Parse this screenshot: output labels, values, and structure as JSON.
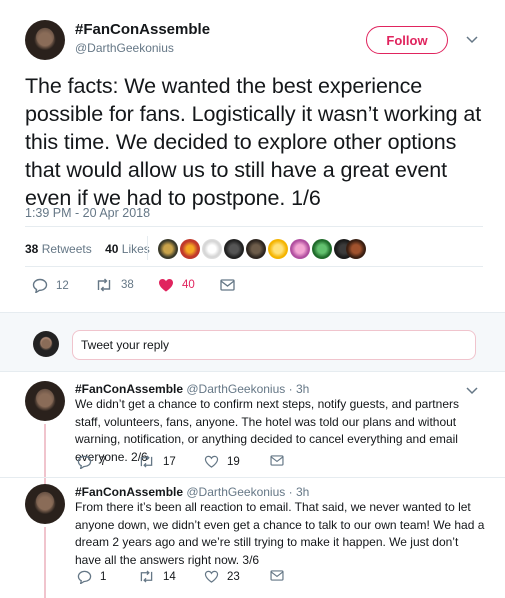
{
  "tweet": {
    "display_name": "#FanConAssemble",
    "handle": "@DarthGeekonius",
    "follow_label": "Follow",
    "text": "The facts: We wanted the best experience possible for fans. Logistically it wasn’t working at this time. We decided to explore other options that would allow us to still have a great event even if we had to postpone. 1/6",
    "timestamp": "1:39 PM - 20 Apr 2018",
    "retweets_count": "38",
    "retweets_label": "Retweets",
    "likes_count": "40",
    "likes_label": "Likes",
    "actions": {
      "replies": "12",
      "retweets": "38",
      "likes": "40"
    },
    "like_color": "#e0245e"
  },
  "reply_box": {
    "placeholder": "Tweet your reply"
  },
  "replies": [
    {
      "display_name": "#FanConAssemble",
      "handle": "@DarthGeekonius",
      "time": "· 3h",
      "text": "We didn’t get a chance to confirm next steps, notify guests, and partners staff, volunteers, fans, anyone. The hotel was told our plans and without warning, notification, or anything decided to cancel everything and email everyone. 2/6",
      "replies": "7",
      "retweets": "17",
      "likes": "19"
    },
    {
      "display_name": "#FanConAssemble",
      "handle": "@DarthGeekonius",
      "time": "· 3h",
      "text": "From there it’s been all reaction to email. That said, we never wanted to let anyone down, we didn’t even get a chance to talk to our own team! We had a dream 2 years ago and we’re still trying to make it happen. We just don’t have all the answers right now. 3/6",
      "replies": "1",
      "retweets": "14",
      "likes": "23"
    }
  ],
  "icons": [
    "reply-icon",
    "retweet-icon",
    "heart-icon",
    "message-icon",
    "chevron-down-icon"
  ]
}
